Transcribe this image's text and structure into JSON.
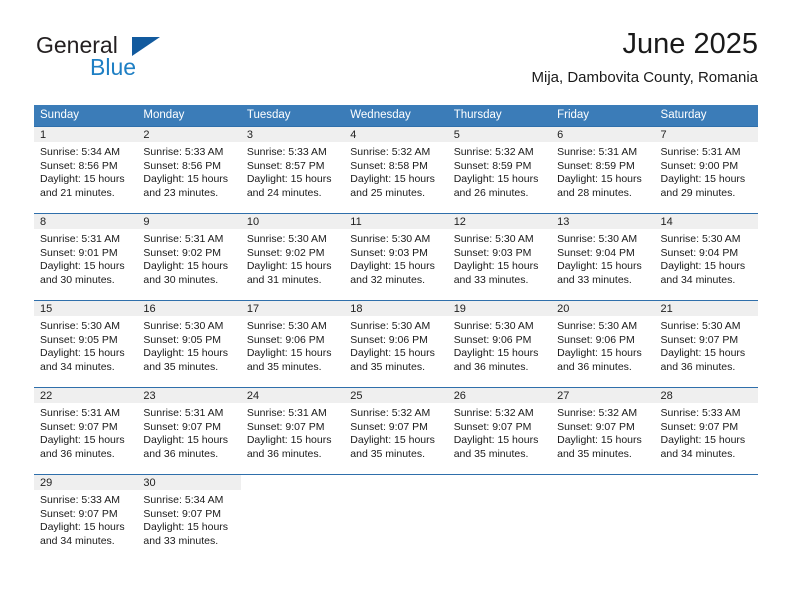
{
  "logo": {
    "word_top": "General",
    "word_bottom": "Blue",
    "triangle_color": "#125a9e",
    "blue_color": "#1e7fc4"
  },
  "header": {
    "month_title": "June 2025",
    "location": "Mija, Dambovita County, Romania"
  },
  "theme": {
    "header_blue": "#3b7cb8",
    "row_divider_blue": "#2f6fab",
    "daynum_strip_gray": "#efefef"
  },
  "calendar": {
    "weekday_headers": [
      "Sunday",
      "Monday",
      "Tuesday",
      "Wednesday",
      "Thursday",
      "Friday",
      "Saturday"
    ],
    "weeks": [
      [
        {
          "day": "1",
          "sunrise": "Sunrise: 5:34 AM",
          "sunset": "Sunset: 8:56 PM",
          "daylight_l1": "Daylight: 15 hours",
          "daylight_l2": "and 21 minutes."
        },
        {
          "day": "2",
          "sunrise": "Sunrise: 5:33 AM",
          "sunset": "Sunset: 8:56 PM",
          "daylight_l1": "Daylight: 15 hours",
          "daylight_l2": "and 23 minutes."
        },
        {
          "day": "3",
          "sunrise": "Sunrise: 5:33 AM",
          "sunset": "Sunset: 8:57 PM",
          "daylight_l1": "Daylight: 15 hours",
          "daylight_l2": "and 24 minutes."
        },
        {
          "day": "4",
          "sunrise": "Sunrise: 5:32 AM",
          "sunset": "Sunset: 8:58 PM",
          "daylight_l1": "Daylight: 15 hours",
          "daylight_l2": "and 25 minutes."
        },
        {
          "day": "5",
          "sunrise": "Sunrise: 5:32 AM",
          "sunset": "Sunset: 8:59 PM",
          "daylight_l1": "Daylight: 15 hours",
          "daylight_l2": "and 26 minutes."
        },
        {
          "day": "6",
          "sunrise": "Sunrise: 5:31 AM",
          "sunset": "Sunset: 8:59 PM",
          "daylight_l1": "Daylight: 15 hours",
          "daylight_l2": "and 28 minutes."
        },
        {
          "day": "7",
          "sunrise": "Sunrise: 5:31 AM",
          "sunset": "Sunset: 9:00 PM",
          "daylight_l1": "Daylight: 15 hours",
          "daylight_l2": "and 29 minutes."
        }
      ],
      [
        {
          "day": "8",
          "sunrise": "Sunrise: 5:31 AM",
          "sunset": "Sunset: 9:01 PM",
          "daylight_l1": "Daylight: 15 hours",
          "daylight_l2": "and 30 minutes."
        },
        {
          "day": "9",
          "sunrise": "Sunrise: 5:31 AM",
          "sunset": "Sunset: 9:02 PM",
          "daylight_l1": "Daylight: 15 hours",
          "daylight_l2": "and 30 minutes."
        },
        {
          "day": "10",
          "sunrise": "Sunrise: 5:30 AM",
          "sunset": "Sunset: 9:02 PM",
          "daylight_l1": "Daylight: 15 hours",
          "daylight_l2": "and 31 minutes."
        },
        {
          "day": "11",
          "sunrise": "Sunrise: 5:30 AM",
          "sunset": "Sunset: 9:03 PM",
          "daylight_l1": "Daylight: 15 hours",
          "daylight_l2": "and 32 minutes."
        },
        {
          "day": "12",
          "sunrise": "Sunrise: 5:30 AM",
          "sunset": "Sunset: 9:03 PM",
          "daylight_l1": "Daylight: 15 hours",
          "daylight_l2": "and 33 minutes."
        },
        {
          "day": "13",
          "sunrise": "Sunrise: 5:30 AM",
          "sunset": "Sunset: 9:04 PM",
          "daylight_l1": "Daylight: 15 hours",
          "daylight_l2": "and 33 minutes."
        },
        {
          "day": "14",
          "sunrise": "Sunrise: 5:30 AM",
          "sunset": "Sunset: 9:04 PM",
          "daylight_l1": "Daylight: 15 hours",
          "daylight_l2": "and 34 minutes."
        }
      ],
      [
        {
          "day": "15",
          "sunrise": "Sunrise: 5:30 AM",
          "sunset": "Sunset: 9:05 PM",
          "daylight_l1": "Daylight: 15 hours",
          "daylight_l2": "and 34 minutes."
        },
        {
          "day": "16",
          "sunrise": "Sunrise: 5:30 AM",
          "sunset": "Sunset: 9:05 PM",
          "daylight_l1": "Daylight: 15 hours",
          "daylight_l2": "and 35 minutes."
        },
        {
          "day": "17",
          "sunrise": "Sunrise: 5:30 AM",
          "sunset": "Sunset: 9:06 PM",
          "daylight_l1": "Daylight: 15 hours",
          "daylight_l2": "and 35 minutes."
        },
        {
          "day": "18",
          "sunrise": "Sunrise: 5:30 AM",
          "sunset": "Sunset: 9:06 PM",
          "daylight_l1": "Daylight: 15 hours",
          "daylight_l2": "and 35 minutes."
        },
        {
          "day": "19",
          "sunrise": "Sunrise: 5:30 AM",
          "sunset": "Sunset: 9:06 PM",
          "daylight_l1": "Daylight: 15 hours",
          "daylight_l2": "and 36 minutes."
        },
        {
          "day": "20",
          "sunrise": "Sunrise: 5:30 AM",
          "sunset": "Sunset: 9:06 PM",
          "daylight_l1": "Daylight: 15 hours",
          "daylight_l2": "and 36 minutes."
        },
        {
          "day": "21",
          "sunrise": "Sunrise: 5:30 AM",
          "sunset": "Sunset: 9:07 PM",
          "daylight_l1": "Daylight: 15 hours",
          "daylight_l2": "and 36 minutes."
        }
      ],
      [
        {
          "day": "22",
          "sunrise": "Sunrise: 5:31 AM",
          "sunset": "Sunset: 9:07 PM",
          "daylight_l1": "Daylight: 15 hours",
          "daylight_l2": "and 36 minutes."
        },
        {
          "day": "23",
          "sunrise": "Sunrise: 5:31 AM",
          "sunset": "Sunset: 9:07 PM",
          "daylight_l1": "Daylight: 15 hours",
          "daylight_l2": "and 36 minutes."
        },
        {
          "day": "24",
          "sunrise": "Sunrise: 5:31 AM",
          "sunset": "Sunset: 9:07 PM",
          "daylight_l1": "Daylight: 15 hours",
          "daylight_l2": "and 36 minutes."
        },
        {
          "day": "25",
          "sunrise": "Sunrise: 5:32 AM",
          "sunset": "Sunset: 9:07 PM",
          "daylight_l1": "Daylight: 15 hours",
          "daylight_l2": "and 35 minutes."
        },
        {
          "day": "26",
          "sunrise": "Sunrise: 5:32 AM",
          "sunset": "Sunset: 9:07 PM",
          "daylight_l1": "Daylight: 15 hours",
          "daylight_l2": "and 35 minutes."
        },
        {
          "day": "27",
          "sunrise": "Sunrise: 5:32 AM",
          "sunset": "Sunset: 9:07 PM",
          "daylight_l1": "Daylight: 15 hours",
          "daylight_l2": "and 35 minutes."
        },
        {
          "day": "28",
          "sunrise": "Sunrise: 5:33 AM",
          "sunset": "Sunset: 9:07 PM",
          "daylight_l1": "Daylight: 15 hours",
          "daylight_l2": "and 34 minutes."
        }
      ],
      [
        {
          "day": "29",
          "sunrise": "Sunrise: 5:33 AM",
          "sunset": "Sunset: 9:07 PM",
          "daylight_l1": "Daylight: 15 hours",
          "daylight_l2": "and 34 minutes."
        },
        {
          "day": "30",
          "sunrise": "Sunrise: 5:34 AM",
          "sunset": "Sunset: 9:07 PM",
          "daylight_l1": "Daylight: 15 hours",
          "daylight_l2": "and 33 minutes."
        },
        {
          "day": "",
          "sunrise": "",
          "sunset": "",
          "daylight_l1": "",
          "daylight_l2": ""
        },
        {
          "day": "",
          "sunrise": "",
          "sunset": "",
          "daylight_l1": "",
          "daylight_l2": ""
        },
        {
          "day": "",
          "sunrise": "",
          "sunset": "",
          "daylight_l1": "",
          "daylight_l2": ""
        },
        {
          "day": "",
          "sunrise": "",
          "sunset": "",
          "daylight_l1": "",
          "daylight_l2": ""
        },
        {
          "day": "",
          "sunrise": "",
          "sunset": "",
          "daylight_l1": "",
          "daylight_l2": ""
        }
      ]
    ]
  }
}
